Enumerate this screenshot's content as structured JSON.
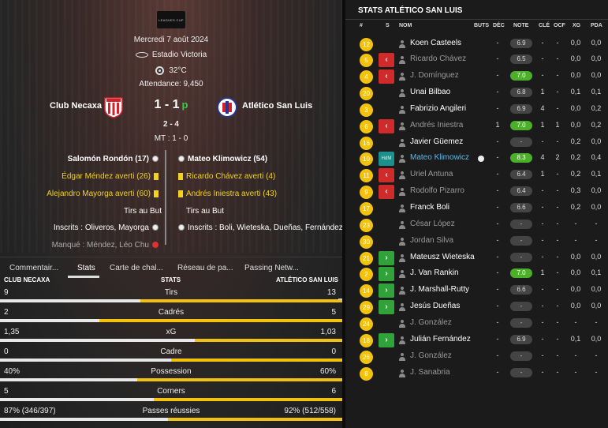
{
  "match": {
    "competition_logo": "LEAGUES CUP",
    "date": "Mercredi 7 août 2024",
    "stadium": "Estadio Victoria",
    "weather": "32°C",
    "attendance": "Attendance: 9,450",
    "home": "Club Necaxa",
    "away": "Atlético San Luis",
    "score": "1 - 1",
    "score_suffix": "p",
    "penalties": "2 - 4",
    "halftime": "MT : 1 - 0",
    "home_events": [
      "Salomón Rondón (17)",
      "Édgar Méndez averti (26)",
      "Alejandro Mayorga averti (60)",
      "Tirs au But",
      "Inscrits : Oliveros, Mayorga",
      "Manqué : Méndez, Léo Chu"
    ],
    "away_events": [
      "Mateo Klimowicz (54)",
      "Ricardo Chávez averti (4)",
      "Andrés Iniestra averti (43)",
      "Tirs au But",
      "Inscrits : Boli, Wieteska, Dueñas, Fernández"
    ],
    "colors": {
      "home_red": "#d6212c",
      "away_blue": "#27348b",
      "yellow": "#f2c20f",
      "green": "#3cc84b"
    }
  },
  "tabs": [
    "Commentair...",
    "Stats",
    "Carte de chal...",
    "Réseau de pa...",
    "Passing Netw..."
  ],
  "stats_header": {
    "home": "CLUB NECAXA",
    "title": "STATS",
    "away": "ATLÉTICO SAN LUIS"
  },
  "stats": [
    {
      "label": "Tirs",
      "home": "9",
      "away": "13",
      "home_share": 0.41
    },
    {
      "label": "Cadrés",
      "home": "2",
      "away": "5",
      "home_share": 0.29
    },
    {
      "label": "xG",
      "home": "1,35",
      "away": "1,03",
      "home_share": 0.57
    },
    {
      "label": "Cadre",
      "home": "0",
      "away": "0",
      "home_share": 0.5
    },
    {
      "label": "Possession",
      "home": "40%",
      "away": "60%",
      "home_share": 0.4
    },
    {
      "label": "Corners",
      "home": "5",
      "away": "6",
      "home_share": 0.45
    },
    {
      "label": "Passes réussies",
      "home": "87% (346/397)",
      "away": "92% (512/558)",
      "home_share": 0.49
    }
  ],
  "panel": {
    "title": "STATS ATLÉTICO SAN LUIS",
    "headers": {
      "s": "S",
      "nom": "NOM",
      "buts": "BUTS",
      "dec": "DÉC",
      "note": "NOTE",
      "cle": "CLÉ",
      "ocf": "OCF",
      "xg": "XG",
      "pda": "PDA"
    },
    "players": [
      {
        "num": "12",
        "sub": "",
        "name": "Koen Casteels",
        "buts": "",
        "dec": "-",
        "note": "6.9",
        "cle": "-",
        "ocf": "-",
        "xg": "0,0",
        "pda": "0,0",
        "bench": false
      },
      {
        "num": "5",
        "sub": "out",
        "name": "Ricardo Chávez",
        "buts": "",
        "dec": "-",
        "note": "6.5",
        "cle": "-",
        "ocf": "-",
        "xg": "0,0",
        "pda": "0,0",
        "bench": true
      },
      {
        "num": "4",
        "sub": "out",
        "name": "J. Domínguez",
        "buts": "",
        "dec": "-",
        "note": "7.0",
        "cle": "-",
        "ocf": "-",
        "xg": "0,0",
        "pda": "0,0",
        "bench": true,
        "good": true
      },
      {
        "num": "20",
        "sub": "",
        "name": "Unai Bilbao",
        "buts": "",
        "dec": "-",
        "note": "6.8",
        "cle": "1",
        "ocf": "-",
        "xg": "0,1",
        "pda": "0,1",
        "bench": false
      },
      {
        "num": "3",
        "sub": "",
        "name": "Fabrizio Angileri",
        "buts": "",
        "dec": "-",
        "note": "6.9",
        "cle": "4",
        "ocf": "-",
        "xg": "0,0",
        "pda": "0,2",
        "bench": false
      },
      {
        "num": "6",
        "sub": "out",
        "name": "Andrés Iniestra",
        "buts": "",
        "dec": "1",
        "note": "7.0",
        "cle": "1",
        "ocf": "1",
        "xg": "0,0",
        "pda": "0,2",
        "bench": true,
        "good": true
      },
      {
        "num": "16",
        "sub": "",
        "name": "Javier Güemez",
        "buts": "",
        "dec": "-",
        "note": "-",
        "cle": "-",
        "ocf": "-",
        "xg": "0,2",
        "pda": "0,0",
        "bench": false
      },
      {
        "num": "10",
        "sub": "man",
        "sub_label": "HdM",
        "name": "Mateo Klimowicz",
        "buts": "",
        "dec": "-",
        "note": "8.3",
        "cle": "4",
        "ocf": "2",
        "xg": "0,2",
        "pda": "0,4",
        "bench": false,
        "good": true,
        "hl": true,
        "goal": true
      },
      {
        "num": "11",
        "sub": "out",
        "name": "Uriel Antuna",
        "buts": "",
        "dec": "-",
        "note": "6.4",
        "cle": "1",
        "ocf": "-",
        "xg": "0,2",
        "pda": "0,1",
        "bench": true
      },
      {
        "num": "9",
        "sub": "out",
        "name": "Rodolfo Pizarro",
        "buts": "",
        "dec": "-",
        "note": "6.4",
        "cle": "-",
        "ocf": "-",
        "xg": "0,3",
        "pda": "0,0",
        "bench": true
      },
      {
        "num": "17",
        "sub": "",
        "name": "Franck Boli",
        "buts": "",
        "dec": "-",
        "note": "6.6",
        "cle": "-",
        "ocf": "-",
        "xg": "0,2",
        "pda": "0,0",
        "bench": false
      },
      {
        "num": "23",
        "sub": "",
        "name": "César López",
        "buts": "",
        "dec": "-",
        "note": "-",
        "cle": "-",
        "ocf": "-",
        "xg": "-",
        "pda": "-",
        "bench": true
      },
      {
        "num": "30",
        "sub": "",
        "name": "Jordan Silva",
        "buts": "",
        "dec": "-",
        "note": "-",
        "cle": "-",
        "ocf": "-",
        "xg": "-",
        "pda": "-",
        "bench": true
      },
      {
        "num": "21",
        "sub": "in",
        "name": "Mateusz Wieteska",
        "buts": "",
        "dec": "-",
        "note": "-",
        "cle": "-",
        "ocf": "-",
        "xg": "0,0",
        "pda": "0,0",
        "bench": false
      },
      {
        "num": "2",
        "sub": "in",
        "name": "J. Van Rankin",
        "buts": "",
        "dec": "-",
        "note": "7.0",
        "cle": "1",
        "ocf": "-",
        "xg": "0,0",
        "pda": "0,1",
        "bench": false,
        "good": true
      },
      {
        "num": "14",
        "sub": "in",
        "name": "J. Marshall-Rutty",
        "buts": "",
        "dec": "-",
        "note": "6.6",
        "cle": "-",
        "ocf": "-",
        "xg": "0,0",
        "pda": "0,0",
        "bench": false
      },
      {
        "num": "29",
        "sub": "in",
        "name": "Jesús Dueñas",
        "buts": "",
        "dec": "-",
        "note": "-",
        "cle": "-",
        "ocf": "-",
        "xg": "0,0",
        "pda": "0,0",
        "bench": false
      },
      {
        "num": "24",
        "sub": "",
        "name": "J. González",
        "buts": "",
        "dec": "-",
        "note": "-",
        "cle": "-",
        "ocf": "-",
        "xg": "-",
        "pda": "-",
        "bench": true
      },
      {
        "num": "18",
        "sub": "in",
        "name": "Julián Fernández",
        "buts": "",
        "dec": "-",
        "note": "6.9",
        "cle": "-",
        "ocf": "-",
        "xg": "0,1",
        "pda": "0,0",
        "bench": false
      },
      {
        "num": "26",
        "sub": "",
        "name": "J. González",
        "buts": "",
        "dec": "-",
        "note": "-",
        "cle": "-",
        "ocf": "-",
        "xg": "-",
        "pda": "-",
        "bench": true
      },
      {
        "num": "8",
        "sub": "",
        "name": "J. Sanabria",
        "buts": "",
        "dec": "-",
        "note": "-",
        "cle": "-",
        "ocf": "-",
        "xg": "-",
        "pda": "-",
        "bench": true
      }
    ]
  }
}
